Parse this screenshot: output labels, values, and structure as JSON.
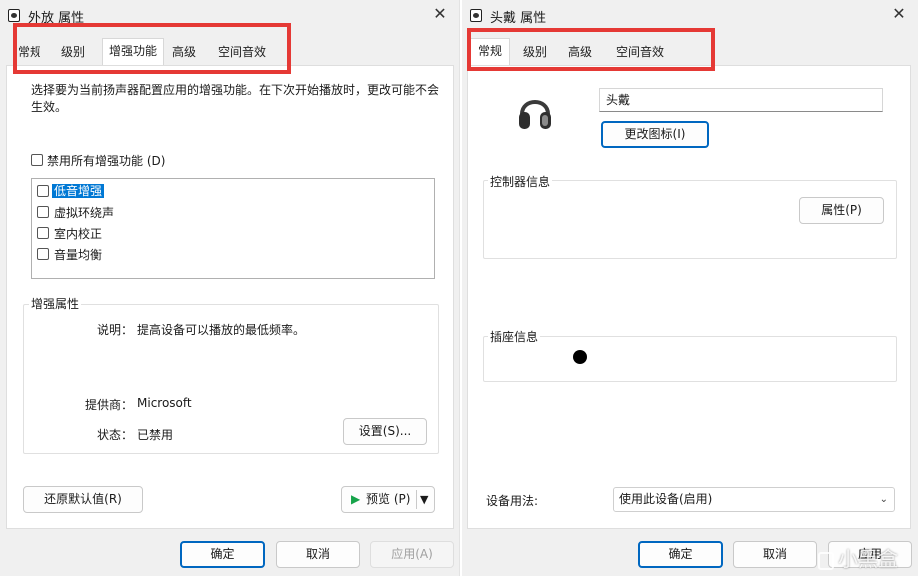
{
  "left_window": {
    "title": "外放 属性",
    "tabs": [
      "常规",
      "级别",
      "增强功能",
      "高级",
      "空间音效"
    ],
    "intro_line1": "选择要为当前扬声器配置应用的增强功能。在下次开始播放时，更改可能不会",
    "intro_line2": "生效。",
    "disable_all_label": "禁用所有增强功能",
    "disable_all_hotkey": "(D)",
    "enhancements": [
      {
        "label": "低音增强",
        "checked": false,
        "selected": true
      },
      {
        "label": "虚拟环绕声",
        "checked": false,
        "selected": false
      },
      {
        "label": "室内校正",
        "checked": false,
        "selected": false
      },
      {
        "label": "音量均衡",
        "checked": false,
        "selected": false
      }
    ],
    "props_group_label": "增强属性",
    "description_label": "说明：",
    "description_value": "提高设备可以播放的最低频率。",
    "provider_label": "提供商：",
    "provider_value": "Microsoft",
    "status_label": "状态：",
    "status_value": "已禁用",
    "settings_button": "设置(S)...",
    "restore_button": "还原默认值(R)",
    "preview_button": "预览 (P)",
    "ok": "确定",
    "cancel": "取消",
    "apply": "应用(A)"
  },
  "right_window": {
    "title": "头戴 属性",
    "tabs": [
      "常规",
      "级别",
      "高级",
      "空间音效"
    ],
    "device_name_value": "头戴",
    "change_icon_button": "更改图标(I)",
    "controller_group_label": "控制器信息",
    "properties_button": "属性(P)",
    "jack_group_label": "插座信息",
    "usage_label": "设备用法:",
    "usage_value": "使用此设备(启用)",
    "ok": "确定",
    "cancel": "取消",
    "apply": "应用"
  },
  "watermark": "小黑盒",
  "colors": {
    "accent": "#0078d4",
    "highlight_box": "#e53935",
    "window_bg": "#f0f0f0"
  },
  "icons": {
    "close": "close-icon",
    "app": "speaker-app-icon",
    "headphones": "headphones-icon",
    "preview_play": "play-icon",
    "dropdown": "chevron-down-icon"
  }
}
